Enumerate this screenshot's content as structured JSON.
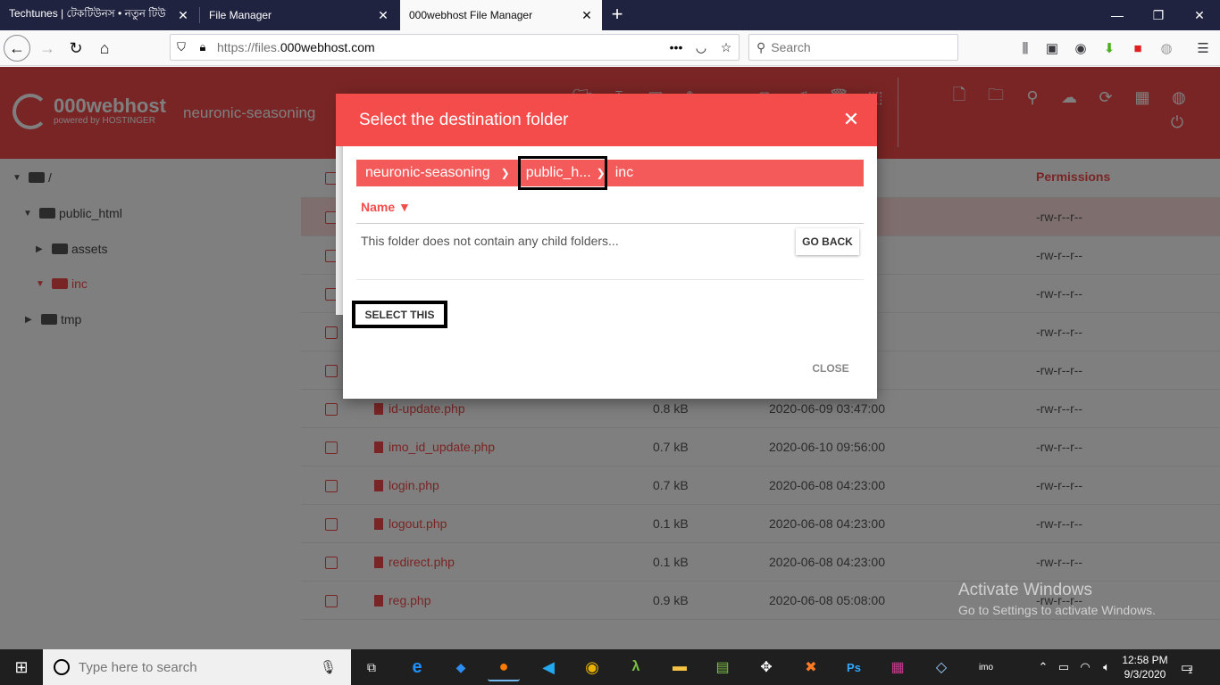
{
  "browser": {
    "tabs": [
      {
        "title": "Techtunes | টেকটিউনস • নতুন টিউ",
        "active": false
      },
      {
        "title": "File Manager",
        "active": false
      },
      {
        "title": "000webhost File Manager",
        "active": true
      }
    ],
    "url_prefix": "https://files.",
    "url_host": "000webhost.com",
    "search_placeholder": "Search"
  },
  "app": {
    "logo_name": "000webhost",
    "logo_sub": "powered by HOSTINGER",
    "header_crumb": "neuronic-seasoning",
    "tree": [
      {
        "label": "/",
        "depth": 0,
        "expanded": true,
        "active": false
      },
      {
        "label": "public_html",
        "depth": 1,
        "expanded": true,
        "active": false
      },
      {
        "label": "assets",
        "depth": 2,
        "expanded": false,
        "active": false
      },
      {
        "label": "inc",
        "depth": 2,
        "expanded": true,
        "active": true
      },
      {
        "label": "tmp",
        "depth": 1,
        "expanded": false,
        "active": false
      }
    ],
    "list_header_permissions": "Permissions",
    "rows": [
      {
        "name": "",
        "size": "",
        "date": "",
        "perm": "-rw-r--r--",
        "selected": true
      },
      {
        "name": "",
        "size": "",
        "date": "",
        "perm": "-rw-r--r--",
        "selected": false
      },
      {
        "name": "",
        "size": "",
        "date": "",
        "perm": "-rw-r--r--",
        "selected": false
      },
      {
        "name": "",
        "size": "",
        "date": "",
        "perm": "-rw-r--r--",
        "selected": false
      },
      {
        "name": "",
        "size": "",
        "date": "",
        "perm": "-rw-r--r--",
        "selected": false
      },
      {
        "name": "id-update.php",
        "size": "0.8 kB",
        "date": "2020-06-09 03:47:00",
        "perm": "-rw-r--r--",
        "selected": false
      },
      {
        "name": "imo_id_update.php",
        "size": "0.7 kB",
        "date": "2020-06-10 09:56:00",
        "perm": "-rw-r--r--",
        "selected": false
      },
      {
        "name": "login.php",
        "size": "0.7 kB",
        "date": "2020-06-08 04:23:00",
        "perm": "-rw-r--r--",
        "selected": false
      },
      {
        "name": "logout.php",
        "size": "0.1 kB",
        "date": "2020-06-08 04:23:00",
        "perm": "-rw-r--r--",
        "selected": false
      },
      {
        "name": "redirect.php",
        "size": "0.1 kB",
        "date": "2020-06-08 04:23:00",
        "perm": "-rw-r--r--",
        "selected": false
      },
      {
        "name": "reg.php",
        "size": "0.9 kB",
        "date": "2020-06-08 05:08:00",
        "perm": "-rw-r--r--",
        "selected": false
      }
    ]
  },
  "modal": {
    "title": "Select the destination folder",
    "crumbs": [
      "neuronic-seasoning",
      "public_h...",
      "inc"
    ],
    "name_col": "Name ▼",
    "empty_msg": "This folder does not contain any child folders...",
    "go_back": "GO BACK",
    "select_this": "SELECT THIS",
    "close": "CLOSE"
  },
  "watermark": {
    "line1": "Activate Windows",
    "line2": "Go to Settings to activate Windows."
  },
  "taskbar": {
    "search_placeholder": "Type here to search",
    "time": "12:58 PM",
    "date": "9/3/2020",
    "notif_count": "1"
  },
  "colors": {
    "brand": "#f44b4b",
    "tab_bar": "#202340"
  }
}
